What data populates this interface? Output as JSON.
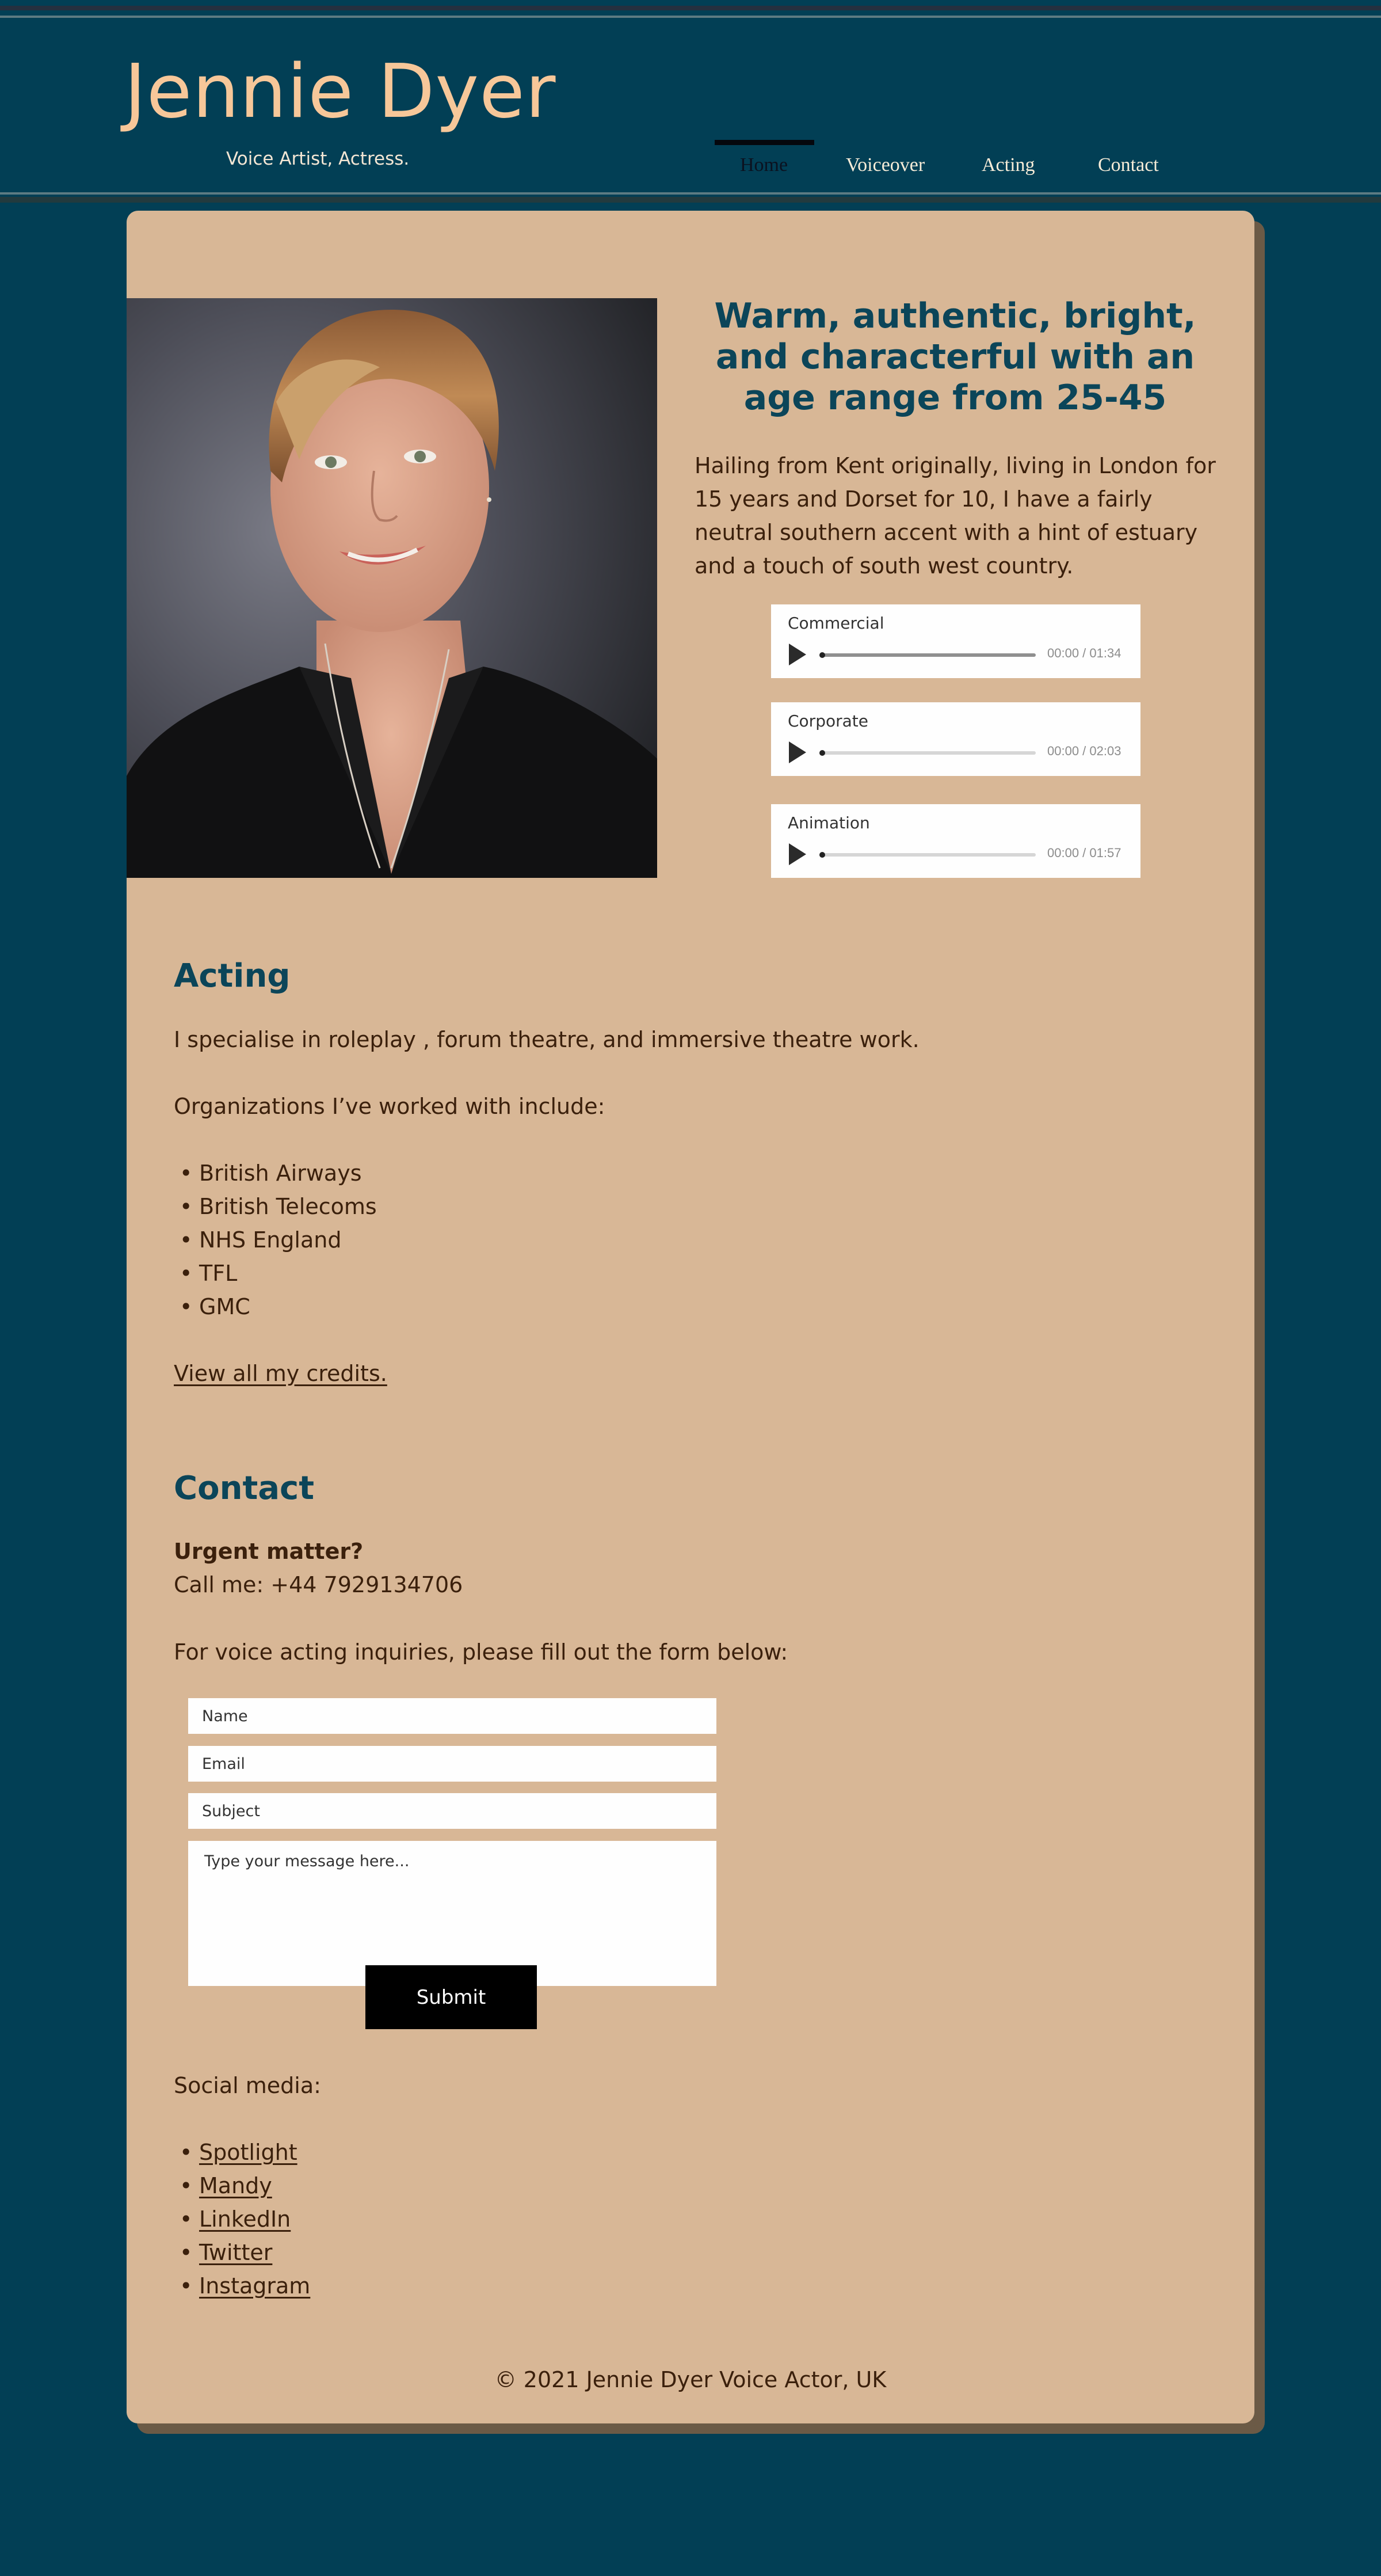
{
  "header": {
    "site_name": "Jennie Dyer",
    "tagline": "Voice Artist, Actress.",
    "nav": [
      {
        "label": "Home",
        "active": true
      },
      {
        "label": "Voiceover",
        "active": false
      },
      {
        "label": "Acting",
        "active": false
      },
      {
        "label": "Contact",
        "active": false
      }
    ]
  },
  "hero": {
    "photo_alt": "Portrait of Jennie Dyer",
    "headline": "Warm, authentic, bright, and characterful with an age range from 25-45",
    "intro": "Hailing from Kent originally, living in London for 15 years and Dorset for 10, I have a fairly neutral southern accent with a hint of estuary and a touch of south west country."
  },
  "audio_players": [
    {
      "title": "Commercial",
      "time": "00:00 / 01:34",
      "progress": 0
    },
    {
      "title": "Corporate",
      "time": "00:00 / 02:03",
      "progress": 0
    },
    {
      "title": "Animation",
      "time": "00:00 / 01:57",
      "progress": 0
    }
  ],
  "acting": {
    "heading": "Acting",
    "specialise": "I specialise in roleplay , forum theatre, and immersive theatre work.",
    "orgs_intro": "Organizations I’ve worked with include:",
    "organizations": [
      "British Airways",
      "British Telecoms",
      "NHS England",
      "TFL",
      "GMC"
    ],
    "credits_link": "View all my credits."
  },
  "contact": {
    "heading": "Contact",
    "urgent": "Urgent matter?",
    "call": "Call me: +44 7929134706",
    "form_intro": "For voice acting inquiries, please fill out the form below:",
    "form": {
      "name_placeholder": "Name",
      "email_placeholder": "Email",
      "subject_placeholder": "Subject",
      "message_placeholder": "Type your message here...",
      "name_value": "",
      "email_value": "",
      "subject_value": "",
      "message_value": "",
      "submit_label": "Submit"
    },
    "social_heading": "Social media:",
    "social_links": [
      "Spotlight",
      "Mandy",
      "LinkedIn",
      "Twitter",
      "Instagram"
    ]
  },
  "footer": {
    "copyright": "© 2021 Jennie Dyer Voice Actor, UK"
  },
  "colors": {
    "page_bg": "#023f55",
    "card_bg": "#d8b796",
    "name_color": "#f7c799",
    "heading_color": "#0b4559",
    "text_color": "#3b200c"
  }
}
